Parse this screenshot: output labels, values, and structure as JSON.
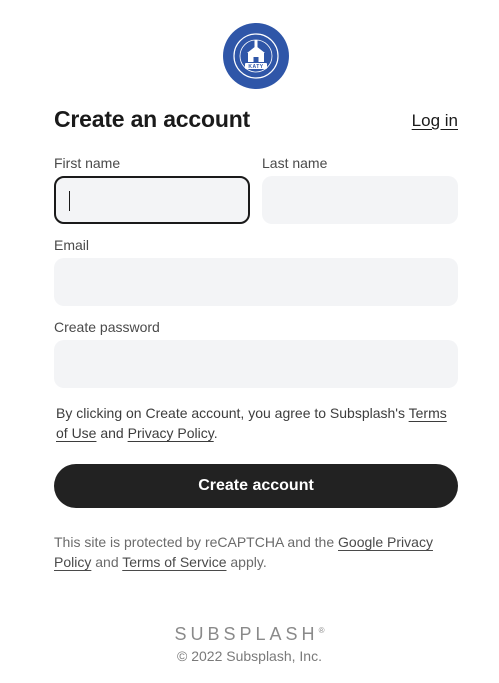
{
  "logo": {
    "word": "KATY",
    "icon": "church-seal-icon",
    "color": "#2f56a8"
  },
  "header": {
    "title": "Create an account",
    "login_label": "Log in"
  },
  "form": {
    "first_name_label": "First name",
    "last_name_label": "Last name",
    "email_label": "Email",
    "password_label": "Create password",
    "first_name_value": "",
    "last_name_value": "",
    "email_value": "",
    "password_value": ""
  },
  "terms": {
    "prefix": "By clicking on Create account, you agree to Subsplash's ",
    "terms_link": "Terms of Use",
    "and": " and ",
    "privacy_link": "Privacy Policy",
    "suffix": "."
  },
  "submit_label": "Create account",
  "recaptcha": {
    "prefix": "This site is protected by reCAPTCHA and the ",
    "privacy_link": "Google Privacy Policy",
    "and": " and ",
    "terms_link": "Terms of Service",
    "suffix": " apply."
  },
  "footer": {
    "brand": "SUBSPLASH",
    "trademark": "®",
    "copyright": "© 2022 Subsplash, Inc."
  },
  "colors": {
    "button_bg": "#222222",
    "input_bg": "#f3f4f6"
  }
}
